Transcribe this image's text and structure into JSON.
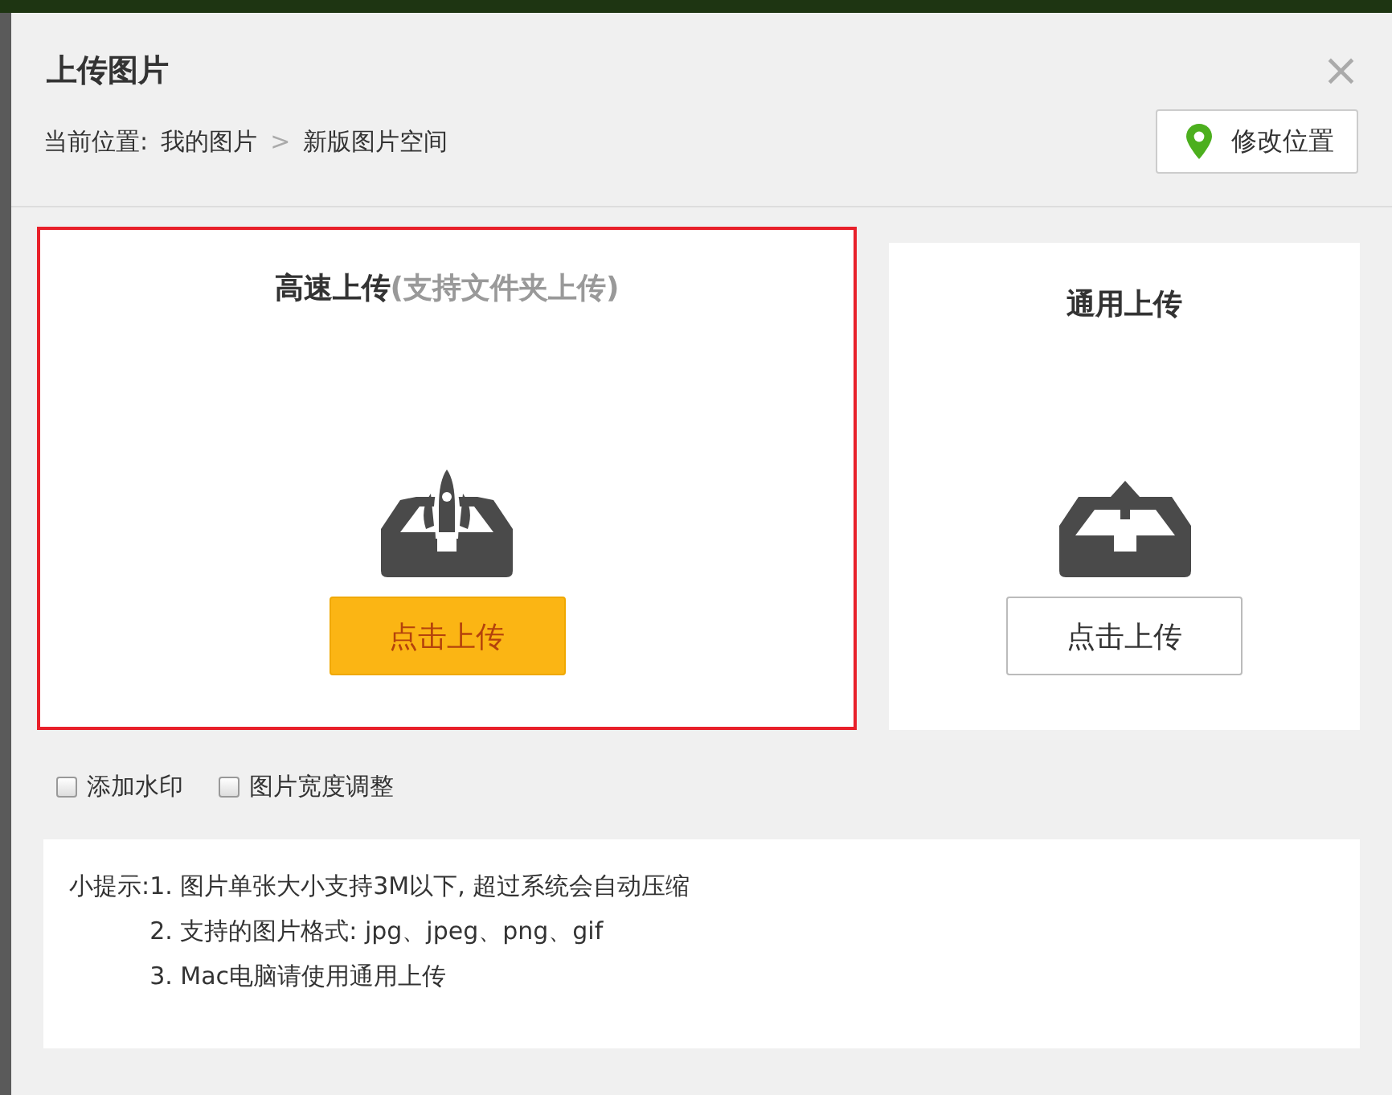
{
  "dialog": {
    "title": "上传图片",
    "close": "×"
  },
  "location": {
    "label": "当前位置:",
    "path": [
      {
        "text": "我的图片"
      },
      {
        "text": "新版图片空间"
      }
    ],
    "separator": ">",
    "button": "修改位置"
  },
  "options": [
    {
      "kind": "rocket",
      "title": "高速上传",
      "note": "(支持文件夹上传)",
      "button": "点击上传",
      "primary": true,
      "highlighted": true
    },
    {
      "kind": "tray",
      "title": "通用上传",
      "button": "点击上传",
      "primary": false,
      "highlighted": false
    }
  ],
  "checkboxes": [
    {
      "label": "添加水印",
      "checked": false
    },
    {
      "label": "图片宽度调整",
      "checked": false
    }
  ],
  "tips": {
    "label": "小提示:",
    "items": [
      "1. 图片单张大小支持3M以下, 超过系统会自动压缩",
      "2. 支持的图片格式: jpg、jpeg、png、gif",
      "3. Mac电脑请使用通用上传"
    ]
  }
}
